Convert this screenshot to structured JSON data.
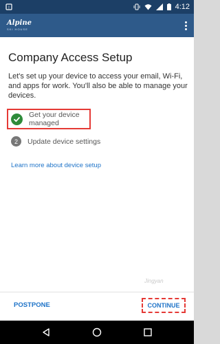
{
  "status_bar": {
    "time": "4:12",
    "icons": [
      "notification-icon",
      "wifi-off-icon",
      "vibrate-icon",
      "wifi-icon",
      "signal-icon",
      "battery-icon"
    ]
  },
  "app_bar": {
    "brand_name": "Alpine",
    "brand_sub": "SKI HOUSE",
    "menu_icon": "more-vert-icon"
  },
  "main": {
    "title": "Company Access Setup",
    "description": "Let's set up your device to access your email, Wi-Fi, and apps for work. You'll also be able to manage your devices.",
    "steps": [
      {
        "number": "1",
        "label": "Get your device managed",
        "status": "complete"
      },
      {
        "number": "2",
        "label": "Update device settings",
        "status": "pending"
      }
    ],
    "learn_more": "Learn more about device setup"
  },
  "actions": {
    "postpone": "POSTPONE",
    "continue": "CONTINUE"
  },
  "watermark": "Jingyan",
  "colors": {
    "status_bar": "#1c3f66",
    "app_bar": "#2e5a8a",
    "link": "#1e73c8",
    "success": "#2e8b3a",
    "highlight": "#e53935"
  }
}
